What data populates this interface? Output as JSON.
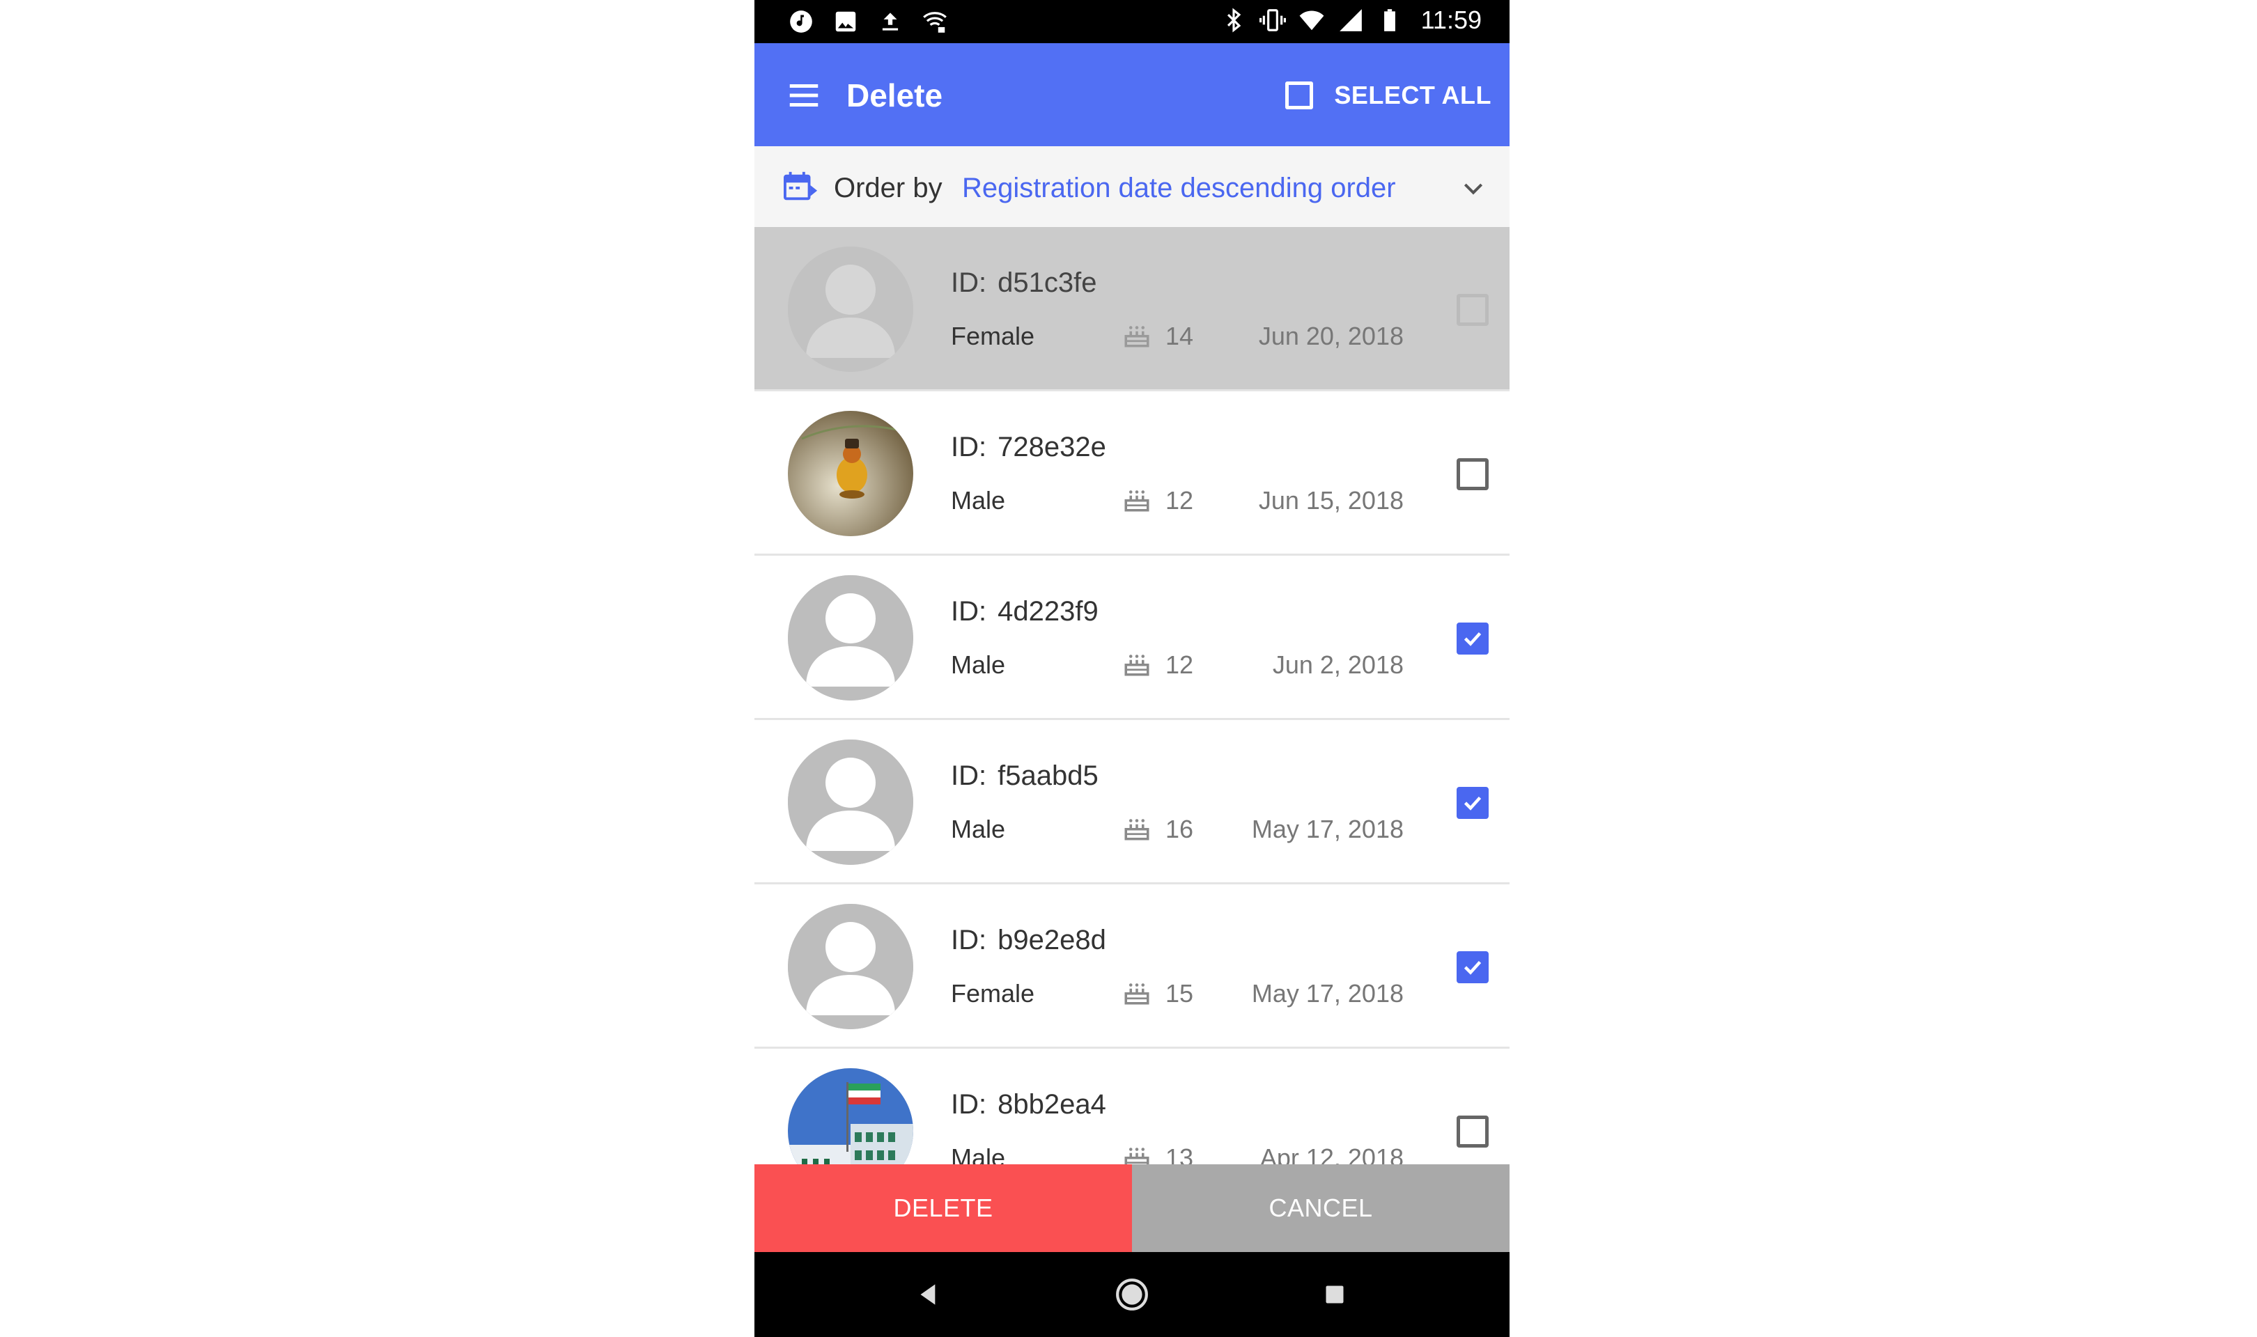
{
  "status_bar": {
    "time": "11:59",
    "left_icons": [
      "music-icon",
      "image-icon",
      "upload-icon",
      "wifi-lock-icon"
    ],
    "right_icons": [
      "bluetooth-icon",
      "vibrate-icon",
      "wifi-icon",
      "signal-icon",
      "battery-icon"
    ]
  },
  "app_bar": {
    "title": "Delete",
    "select_all_label": "SELECT ALL",
    "background": "#5270f4"
  },
  "order_bar": {
    "label": "Order by",
    "value": "Registration date descending order"
  },
  "list": {
    "id_prefix": "ID:",
    "rows": [
      {
        "id": "d51c3fe",
        "gender": "Female",
        "age": "14",
        "date": "Jun 20, 2018",
        "checked": false,
        "disabled": true,
        "avatar": "placeholder"
      },
      {
        "id": "728e32e",
        "gender": "Male",
        "age": "12",
        "date": "Jun 15, 2018",
        "checked": false,
        "disabled": false,
        "avatar": "photo-toy"
      },
      {
        "id": "4d223f9",
        "gender": "Male",
        "age": "12",
        "date": "Jun 2, 2018",
        "checked": true,
        "disabled": false,
        "avatar": "placeholder"
      },
      {
        "id": "f5aabd5",
        "gender": "Male",
        "age": "16",
        "date": "May 17, 2018",
        "checked": true,
        "disabled": false,
        "avatar": "placeholder"
      },
      {
        "id": "b9e2e8d",
        "gender": "Female",
        "age": "15",
        "date": "May 17, 2018",
        "checked": true,
        "disabled": false,
        "avatar": "placeholder"
      },
      {
        "id": "8bb2ea4",
        "gender": "Male",
        "age": "13",
        "date": "Apr 12, 2018",
        "checked": false,
        "disabled": false,
        "avatar": "photo-building"
      }
    ]
  },
  "actions": {
    "delete_label": "DELETE",
    "cancel_label": "CANCEL",
    "delete_color": "#fa5052",
    "cancel_color": "#a9a9a9"
  },
  "accent_color": "#4a67f0"
}
